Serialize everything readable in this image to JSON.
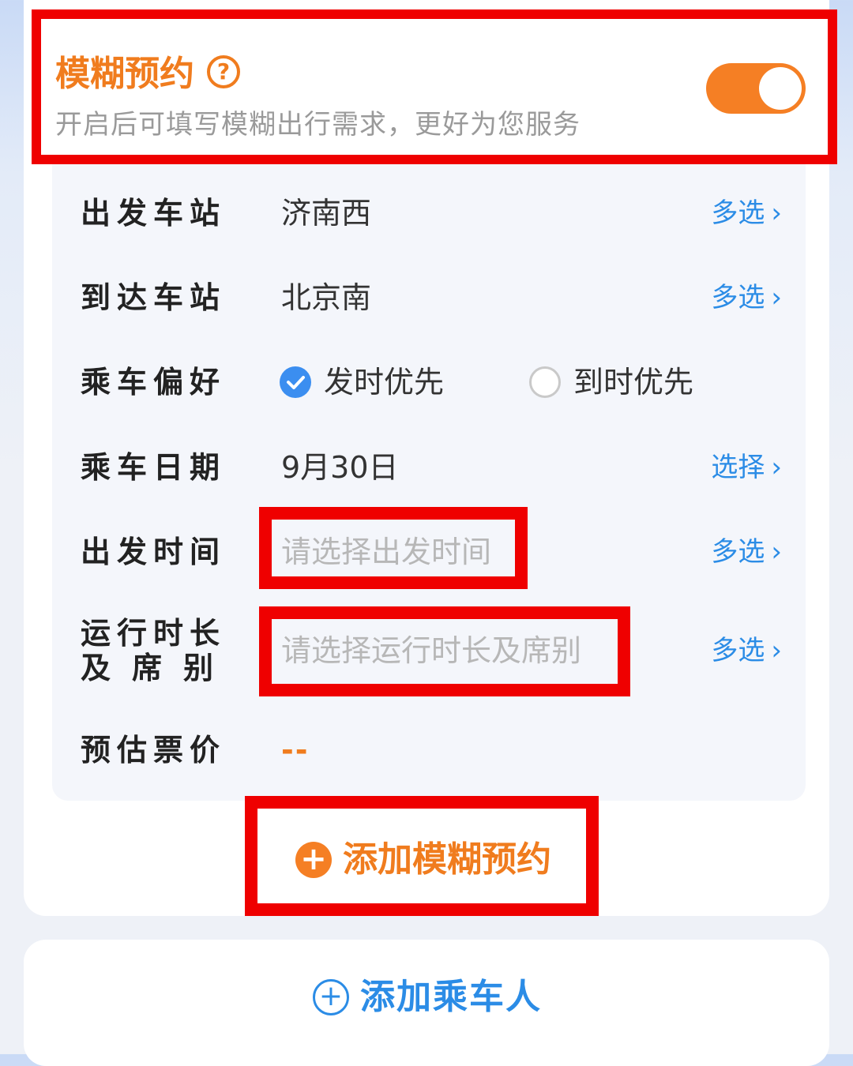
{
  "fuzzy": {
    "title": "模糊预约",
    "help": "?",
    "subtitle": "开启后可填写模糊出行需求，更好为您服务",
    "toggle_on": true
  },
  "form": {
    "departure_station": {
      "label": "出发车站",
      "value": "济南西",
      "action": "多选"
    },
    "arrival_station": {
      "label": "到达车站",
      "value": "北京南",
      "action": "多选"
    },
    "preference": {
      "label": "乘车偏好",
      "options": [
        {
          "label": "发时优先",
          "checked": true
        },
        {
          "label": "到时优先",
          "checked": false
        }
      ]
    },
    "date": {
      "label": "乘车日期",
      "value": "9月30日",
      "action": "选择"
    },
    "depart_time": {
      "label": "出发时间",
      "placeholder": "请选择出发时间",
      "action": "多选"
    },
    "duration_seat": {
      "label_line1": "运行时长",
      "label_line2": "及席别",
      "placeholder": "请选择运行时长及席别",
      "action": "多选"
    },
    "price": {
      "label": "预估票价",
      "value": "--"
    }
  },
  "actions": {
    "add_fuzzy": "添加模糊预约",
    "add_fuzzy_icon": "+",
    "add_passenger": "添加乘车人",
    "add_passenger_icon": "+"
  },
  "colors": {
    "accent_orange": "#f07c1e",
    "link_blue": "#2b8ce6",
    "highlight_red": "#ef0000"
  }
}
